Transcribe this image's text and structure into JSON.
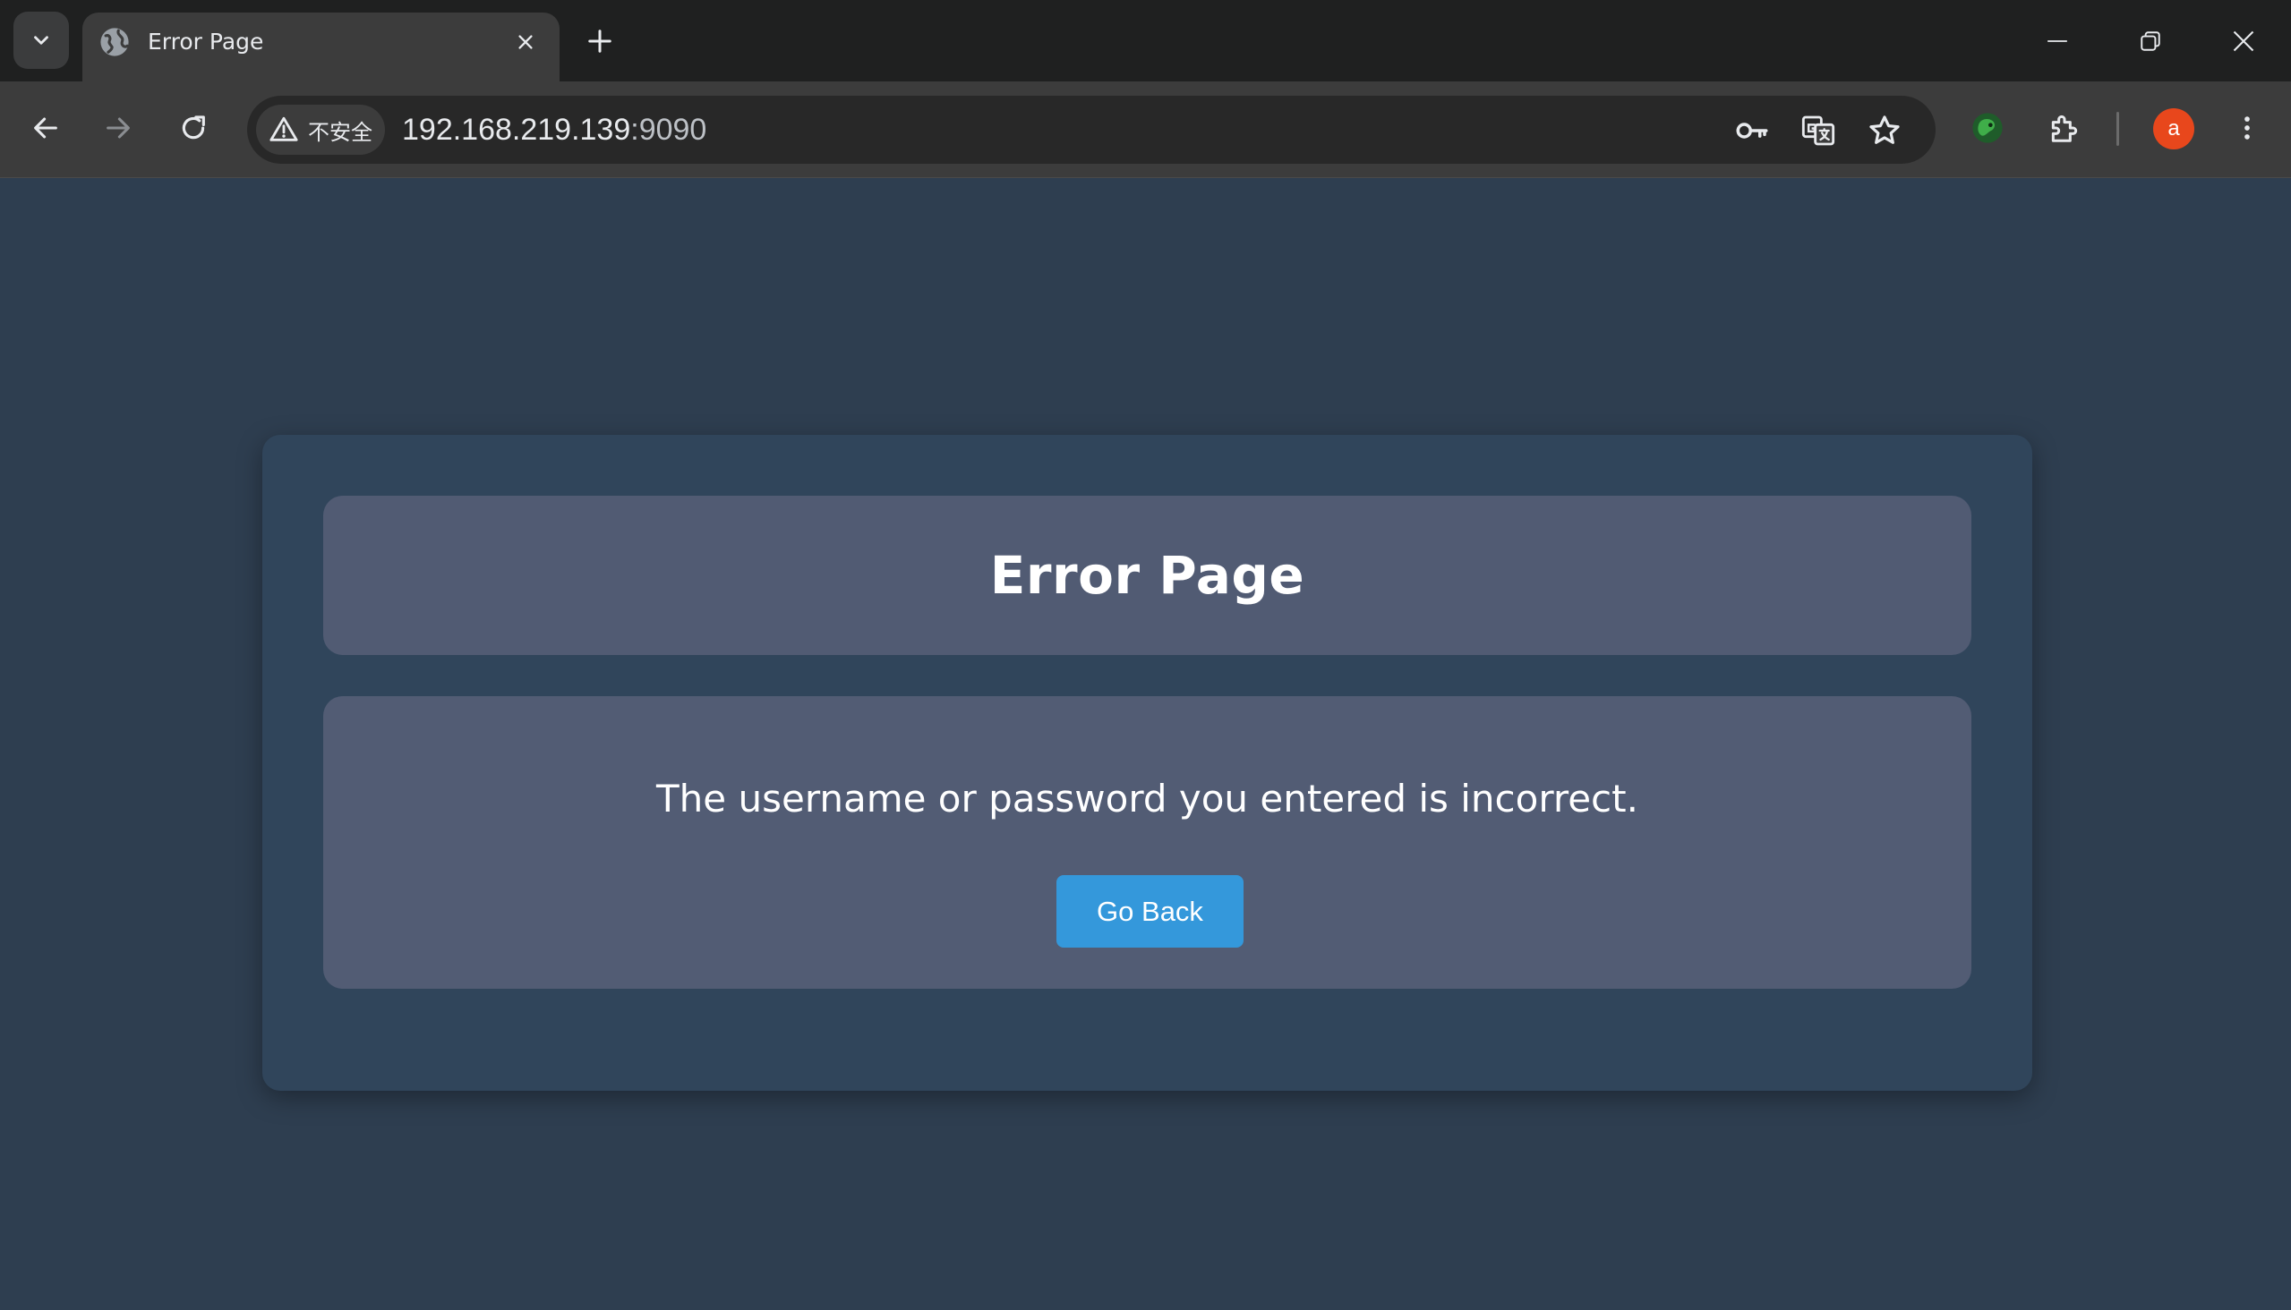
{
  "browser": {
    "tab": {
      "title": "Error Page"
    },
    "address_bar": {
      "security_label": "不安全",
      "url_host": "192.168.219.139",
      "url_port": ":9090"
    },
    "profile": {
      "avatar_letter": "a",
      "avatar_color": "#e8471c"
    },
    "icons": {
      "tab_search": "chevron-down-icon",
      "favicon": "globe-icon",
      "tab_close": "close-icon",
      "new_tab": "plus-icon",
      "minimize": "minimize-icon",
      "restore": "restore-icon",
      "window_close": "close-icon",
      "back": "arrow-left-icon",
      "forward": "arrow-right-icon",
      "reload": "reload-icon",
      "security": "warning-icon",
      "password": "key-icon",
      "translate": "translate-icon",
      "bookmark": "star-icon",
      "extension_green": "extension-icon",
      "extensions": "puzzle-icon",
      "menu": "kebab-menu-icon"
    }
  },
  "page": {
    "title": "Error Page",
    "message": "The username or password you entered is incorrect.",
    "go_back_label": "Go Back",
    "colors": {
      "background": "#2e3e50",
      "card": "#30455b",
      "panel": "#515b73",
      "button": "#3498db"
    }
  }
}
